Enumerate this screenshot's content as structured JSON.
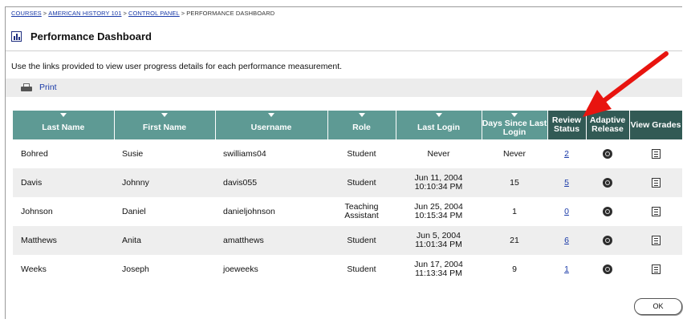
{
  "breadcrumb": {
    "items": [
      "COURSES",
      "AMERICAN HISTORY 101",
      "CONTROL PANEL"
    ],
    "separator": ">",
    "current": "PERFORMANCE DASHBOARD"
  },
  "page": {
    "title": "Performance Dashboard",
    "title_icon": "bar-chart-icon",
    "intro": "Use the links provided to view user progress details for each performance measurement."
  },
  "toolbar": {
    "print_label": "Print",
    "print_icon": "printer-icon"
  },
  "table": {
    "columns": [
      {
        "key": "last_name",
        "label": "Last Name"
      },
      {
        "key": "first_name",
        "label": "First Name"
      },
      {
        "key": "username",
        "label": "Username"
      },
      {
        "key": "role",
        "label": "Role"
      },
      {
        "key": "last_login",
        "label": "Last Login"
      },
      {
        "key": "days_since",
        "label": "Days Since Last Login"
      },
      {
        "key": "review_status",
        "label": "Review Status"
      },
      {
        "key": "adaptive_release",
        "label": "Adaptive Release"
      },
      {
        "key": "view_grades",
        "label": "View Grades"
      }
    ],
    "rows": [
      {
        "last_name": "Bohred",
        "first_name": "Susie",
        "username": "swilliams04",
        "role": "Student",
        "last_login": "Never",
        "last_login_time": "",
        "days_since": "Never",
        "review_status": "2"
      },
      {
        "last_name": "Davis",
        "first_name": "Johnny",
        "username": "davis055",
        "role": "Student",
        "last_login": "Jun 11, 2004",
        "last_login_time": "10:10:34 PM",
        "days_since": "15",
        "review_status": "5"
      },
      {
        "last_name": "Johnson",
        "first_name": "Daniel",
        "username": "danieljohnson",
        "role": "Teaching Assistant",
        "last_login": "Jun 25, 2004",
        "last_login_time": "10:15:34 PM",
        "days_since": "1",
        "review_status": "0"
      },
      {
        "last_name": "Matthews",
        "first_name": "Anita",
        "username": "amatthews",
        "role": "Student",
        "last_login": "Jun 5, 2004",
        "last_login_time": "11:01:34 PM",
        "days_since": "21",
        "review_status": "6"
      },
      {
        "last_name": "Weeks",
        "first_name": "Joseph",
        "username": "joeweeks",
        "role": "Student",
        "last_login": "Jun 17, 2004",
        "last_login_time": "11:13:34 PM",
        "days_since": "9",
        "review_status": "1"
      }
    ]
  },
  "footer": {
    "ok_label": "OK"
  },
  "colors": {
    "header_bg": "#5e9a94",
    "header_dark": "#325a55",
    "arrow": "#e8140f",
    "link": "#1a3aa8"
  }
}
